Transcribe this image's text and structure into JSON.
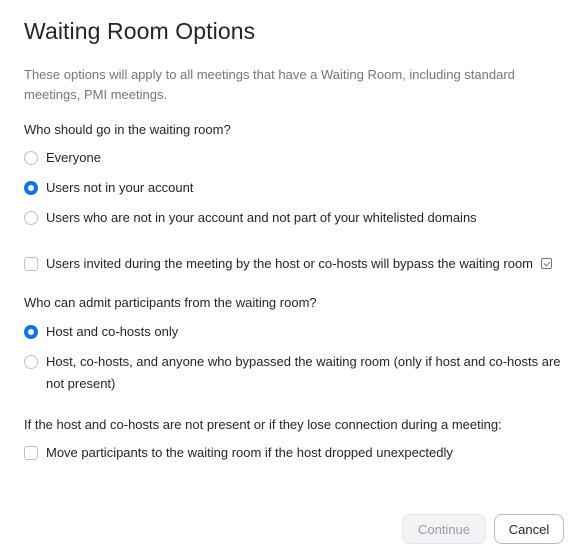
{
  "dialog": {
    "title": "Waiting Room Options",
    "description": "These options will apply to all meetings that have a Waiting Room, including standard meetings, PMI meetings."
  },
  "who_goes": {
    "heading": "Who should go in the waiting room?",
    "options": [
      {
        "label": "Everyone",
        "checked": false
      },
      {
        "label": "Users not in your account",
        "checked": true
      },
      {
        "label": "Users who are not in your account and not part of your whitelisted domains",
        "checked": false
      }
    ]
  },
  "bypass": {
    "label": "Users invited during the meeting by the host or co-hosts will bypass the waiting room",
    "checked": false,
    "info_icon": "info-icon"
  },
  "who_admits": {
    "heading": "Who can admit participants from the waiting room?",
    "options": [
      {
        "label": "Host and co-hosts only",
        "checked": true
      },
      {
        "label": "Host, co-hosts, and anyone who bypassed the waiting room (only if host and co-hosts are not present)",
        "checked": false
      }
    ]
  },
  "host_absent": {
    "heading": "If the host and co-hosts are not present or if they lose connection during a meeting:",
    "checkbox_label": "Move participants to the waiting room if the host dropped unexpectedly",
    "checked": false
  },
  "buttons": {
    "continue": "Continue",
    "cancel": "Cancel"
  },
  "colors": {
    "accent": "#0e72ed",
    "text": "#232333",
    "muted": "#747487"
  }
}
